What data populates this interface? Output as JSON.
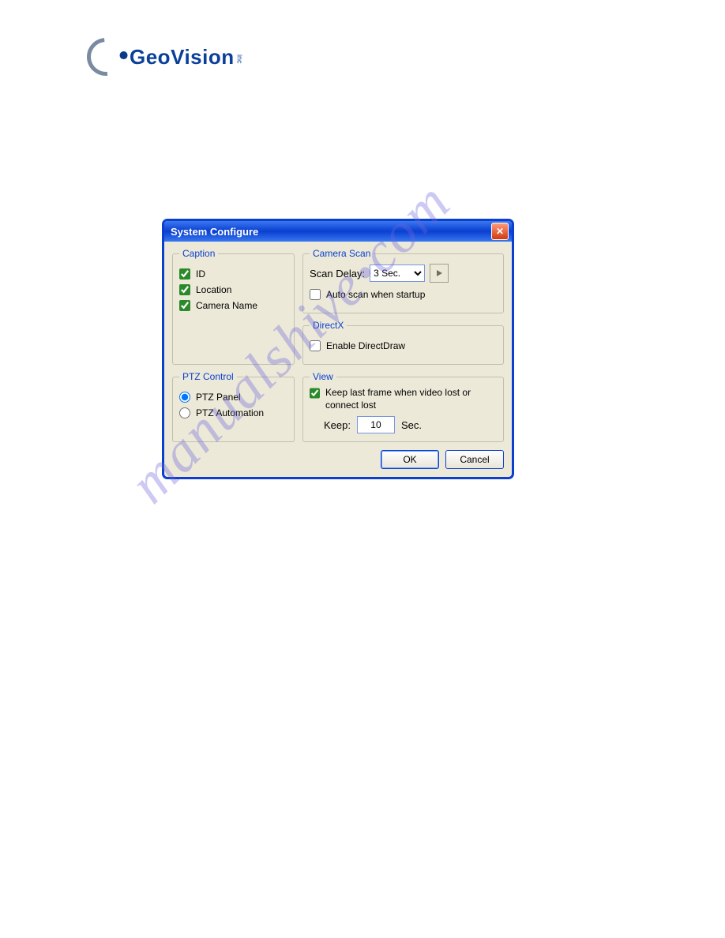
{
  "logo": {
    "text": "GeoVision",
    "inc": "inc"
  },
  "watermark": "manualshive   com",
  "dialog": {
    "title": "System Configure",
    "close_symbol": "✕",
    "caption": {
      "legend": "Caption",
      "id_label": "ID",
      "id_checked": true,
      "location_label": "Location",
      "location_checked": true,
      "camname_label": "Camera Name",
      "camname_checked": true
    },
    "camerascan": {
      "legend": "Camera Scan",
      "scan_delay_label": "Scan Delay:",
      "scan_delay_value": "3 Sec.",
      "autoscan_label": "Auto scan when startup",
      "autoscan_checked": false
    },
    "directx": {
      "legend": "DirectX",
      "enable_label": "Enable DirectDraw",
      "enable_checked": false
    },
    "ptz": {
      "legend": "PTZ Control",
      "panel_label": "PTZ Panel",
      "automation_label": "PTZ Automation",
      "selected": "panel"
    },
    "view": {
      "legend": "View",
      "keeplast_label": "Keep last frame when video lost or connect lost",
      "keeplast_checked": true,
      "keep_label": "Keep:",
      "keep_value": "10",
      "keep_unit": "Sec."
    },
    "buttons": {
      "ok": "OK",
      "cancel": "Cancel"
    }
  }
}
